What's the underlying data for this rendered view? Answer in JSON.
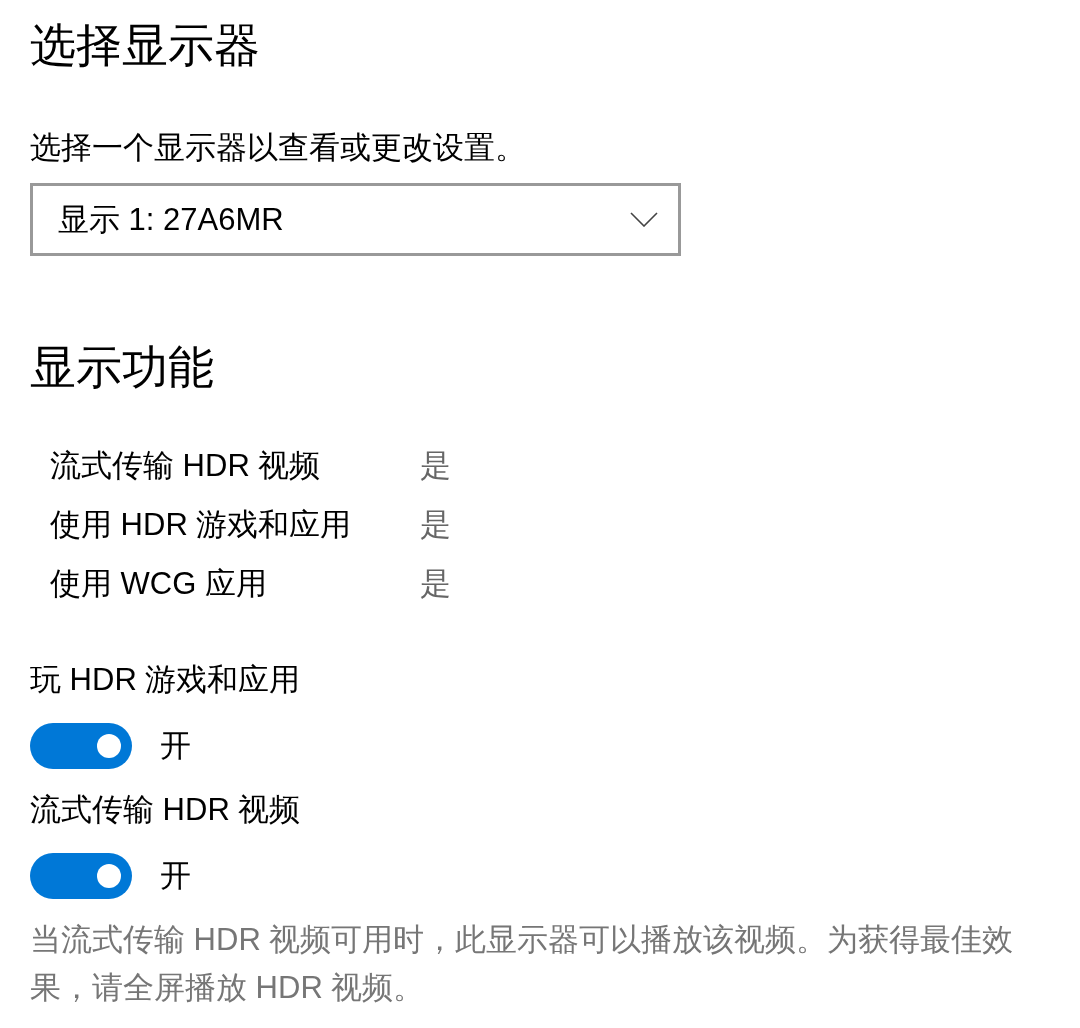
{
  "display_select": {
    "heading": "选择显示器",
    "instruction": "选择一个显示器以查看或更改设置。",
    "dropdown": {
      "value": "显示 1: 27A6MR"
    }
  },
  "display_features": {
    "heading": "显示功能",
    "capabilities": [
      {
        "label": "流式传输 HDR 视频",
        "value": "是"
      },
      {
        "label": "使用 HDR 游戏和应用",
        "value": "是"
      },
      {
        "label": "使用 WCG 应用",
        "value": "是"
      }
    ]
  },
  "settings": [
    {
      "label": "玩 HDR 游戏和应用",
      "on": true,
      "state_text": "开"
    },
    {
      "label": "流式传输 HDR 视频",
      "on": true,
      "state_text": "开"
    }
  ],
  "note": "当流式传输 HDR 视频可用时，此显示器可以播放该视频。为获得最佳效果，请全屏播放 HDR 视频。"
}
